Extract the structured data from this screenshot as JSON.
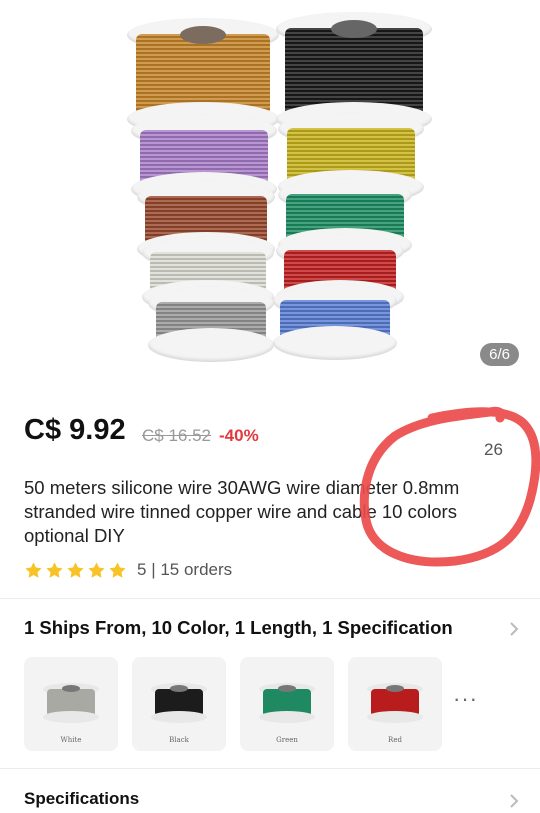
{
  "gallery": {
    "counter": "6/6"
  },
  "product": {
    "price": "C$ 9.92",
    "original_price": "C$ 16.52",
    "discount": "-40%",
    "wish_count": "26",
    "title": "50 meters silicone wire 30AWG wire diameter 0.8mm stranded wire tinned copper wire and cable 10 colors optional DIY",
    "rating": {
      "stars": 5,
      "score": "5",
      "orders": "15 orders"
    }
  },
  "variants": {
    "label": "1 Ships From, 10 Color, 1 Length, 1 Specification",
    "options": [
      {
        "label": "White",
        "color": "#cfcfcf"
      },
      {
        "label": "Black",
        "color": "#1c1c1c"
      },
      {
        "label": "Green",
        "color": "#1f8a62"
      },
      {
        "label": "Red",
        "color": "#b81c1c"
      }
    ],
    "more": "···"
  },
  "specifications": {
    "label": "Specifications"
  },
  "colors": {
    "accent": "#e4393c",
    "star": "#f7c325",
    "annotation": "#ec4a4a"
  }
}
